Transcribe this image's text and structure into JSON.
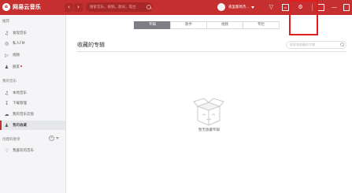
{
  "app": {
    "name": "网易云音乐",
    "search_placeholder": "搜索音乐，视频，歌词，电台",
    "username": "夜里都周杰..."
  },
  "sidebar": {
    "recommend_title": "推荐",
    "recommend_items": [
      {
        "label": "发现音乐",
        "icon": "music-note-icon"
      },
      {
        "label": "私人FM",
        "icon": "radio-icon"
      },
      {
        "label": "视频",
        "icon": "video-icon"
      },
      {
        "label": "朋友",
        "icon": "friends-icon"
      }
    ],
    "my_music_title": "我的音乐",
    "my_music_items": [
      {
        "label": "本地音乐",
        "icon": "music-note-icon"
      },
      {
        "label": "下载管理",
        "icon": "download-icon"
      },
      {
        "label": "我的音乐云盘",
        "icon": "cloud-icon"
      },
      {
        "label": "我的收藏",
        "icon": "collection-icon"
      }
    ],
    "playlists_title": "创建的歌单",
    "playlist_items": [
      {
        "label": "我喜欢的音乐",
        "icon": "heart-icon"
      }
    ]
  },
  "tabs": [
    "专辑",
    "歌手",
    "视频",
    "专栏"
  ],
  "active_tab": "专辑",
  "main": {
    "title": "收藏的专辑",
    "filter_placeholder": "搜索我收藏的专辑",
    "empty_text": "暂无收藏专辑"
  },
  "colors": {
    "brand": "#c62f2f",
    "highlight": "#e01e1e",
    "active_tab": "#7c7d85"
  }
}
